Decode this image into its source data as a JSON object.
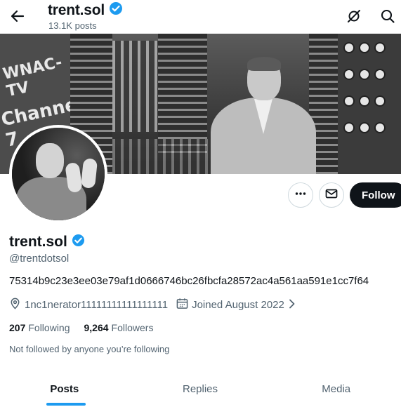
{
  "header": {
    "display_name": "trent.sol",
    "post_count": "13.1K posts",
    "icons": [
      "back-arrow-icon",
      "grok-icon",
      "search-icon"
    ]
  },
  "profile": {
    "display_name": "trent.sol",
    "handle": "@trentdotsol",
    "bio": "75314b9c23e3ee03e79af1d0666746bc26fbcfa28572ac4a561aa591e1cc7f64",
    "location": "1nc1nerator11111111111111111",
    "joined": "Joined August 2022",
    "following_count": "207",
    "following_label": "Following",
    "followers_count": "9,264",
    "followers_label": "Followers",
    "followed_by": "Not followed by anyone you’re following",
    "verified_color": "#1d9bf0"
  },
  "actions": {
    "more_icon": "more-icon",
    "message_icon": "message-icon",
    "follow_label": "Follow"
  },
  "banner": {
    "sign_line1": "WNAC-TV",
    "sign_line2": "Channel 7"
  },
  "tabs": [
    {
      "label": "Posts",
      "active": true
    },
    {
      "label": "Replies",
      "active": false
    },
    {
      "label": "Media",
      "active": false
    }
  ],
  "colors": {
    "accent": "#1d9bf0",
    "text_primary": "#0f1419",
    "text_secondary": "#536471",
    "follow_bg": "#0f1419"
  }
}
